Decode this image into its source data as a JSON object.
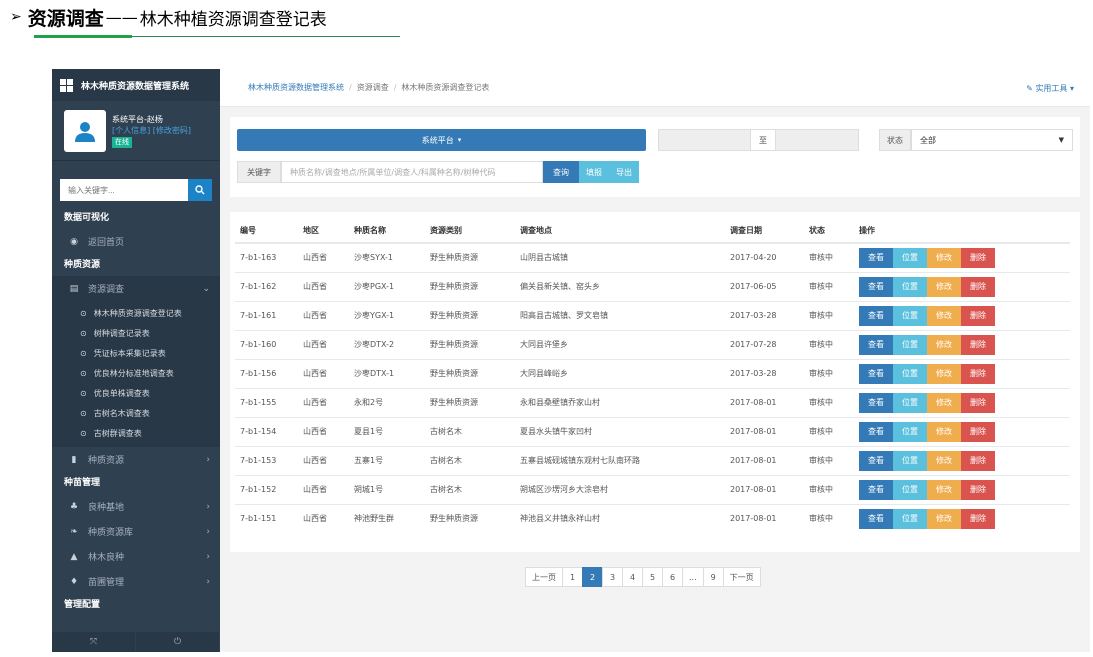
{
  "doc": {
    "arrow": "➢",
    "title": "资源调查",
    "dash": "——",
    "subtitle": "林木种植资源调查登记表"
  },
  "sidebar": {
    "brand": "林木种质资源数据管理系统",
    "user": {
      "name": "系统平台-赵杨",
      "links": "[个人信息] [修改密码]",
      "status": "在线"
    },
    "search_placeholder": "输入关键字...",
    "sections": [
      {
        "title": "数据可视化"
      },
      {
        "title": "种质资源"
      },
      {
        "title": "种苗管理"
      },
      {
        "title": "管理配置"
      }
    ],
    "home": "返回首页",
    "survey": "资源调查",
    "sub_items": [
      "林木种质资源调查登记表",
      "树种调查记录表",
      "凭证标本采集记录表",
      "优良林分标准地调查表",
      "优良单株调查表",
      "古树名木调查表",
      "古树群调查表"
    ],
    "germplasm": "种质资源",
    "seedling_items": [
      "良种基地",
      "种质资源库",
      "林木良种",
      "苗圃管理"
    ]
  },
  "topbar": {
    "breadcrumb": [
      "林木种质资源数据管理系统",
      "资源调查",
      "林木种质资源调查登记表"
    ],
    "separator": "/",
    "tools": "实用工具"
  },
  "filters": {
    "platform": "系统平台",
    "date_to": "至",
    "status_label": "状态",
    "status_value": "全部",
    "keyword_label": "关键字",
    "keyword_placeholder": "种质名称/调查地点/所属单位/调查人/科属种名称/树种代码",
    "query": "查询",
    "fill": "填报",
    "export": "导出"
  },
  "table": {
    "headers": [
      "编号",
      "地区",
      "种质名称",
      "资源类别",
      "调查地点",
      "调查日期",
      "状态",
      "操作"
    ],
    "rows": [
      [
        "7-b1-163",
        "山西省",
        "沙枣SYX-1",
        "野生种质资源",
        "山阴县古城镇",
        "2017-04-20",
        "审核中"
      ],
      [
        "7-b1-162",
        "山西省",
        "沙枣PGX-1",
        "野生种质资源",
        "偏关县新关镇、窑头乡",
        "2017-06-05",
        "审核中"
      ],
      [
        "7-b1-161",
        "山西省",
        "沙枣YGX-1",
        "野生种质资源",
        "阳高县古城镇、罗文皂镇",
        "2017-03-28",
        "审核中"
      ],
      [
        "7-b1-160",
        "山西省",
        "沙枣DTX-2",
        "野生种质资源",
        "大同县许堡乡",
        "2017-07-28",
        "审核中"
      ],
      [
        "7-b1-156",
        "山西省",
        "沙枣DTX-1",
        "野生种质资源",
        "大同县峰峪乡",
        "2017-03-28",
        "审核中"
      ],
      [
        "7-b1-155",
        "山西省",
        "永和2号",
        "野生种质资源",
        "永和县桑壁镇乔家山村",
        "2017-08-01",
        "审核中"
      ],
      [
        "7-b1-154",
        "山西省",
        "夏县1号",
        "古树名木",
        "夏县水头镇牛家凹村",
        "2017-08-01",
        "审核中"
      ],
      [
        "7-b1-153",
        "山西省",
        "五寨1号",
        "古树名木",
        "五寨县城砚城镇东观村七队南环路",
        "2017-08-01",
        "审核中"
      ],
      [
        "7-b1-152",
        "山西省",
        "朔城1号",
        "古树名木",
        "朔城区沙塄河乡大涂皂村",
        "2017-08-01",
        "审核中"
      ],
      [
        "7-b1-151",
        "山西省",
        "神池野生群",
        "野生种质资源",
        "神池县义井镇永祥山村",
        "2017-08-01",
        "审核中"
      ]
    ],
    "ops": [
      "查看",
      "位置",
      "修改",
      "删除"
    ]
  },
  "pagination": [
    "上一页",
    "1",
    "2",
    "3",
    "4",
    "5",
    "6",
    "...",
    "9",
    "下一页"
  ],
  "pagination_active": "2"
}
